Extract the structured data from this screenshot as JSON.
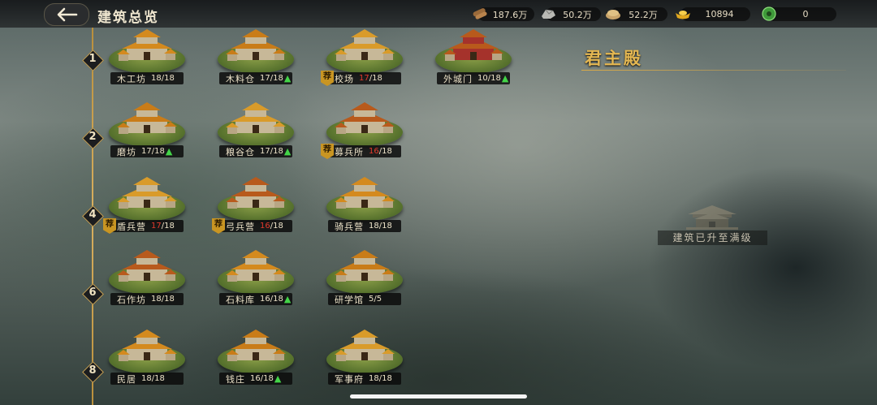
{
  "header": {
    "title": "建筑总览"
  },
  "resources": [
    {
      "icon": "wood-icon",
      "value": "187.6万"
    },
    {
      "icon": "stone-icon",
      "value": "50.2万"
    },
    {
      "icon": "grain-icon",
      "value": "52.2万"
    },
    {
      "icon": "gold-ingot-icon",
      "value": "10894"
    },
    {
      "icon": "jade-icon",
      "value": "0"
    }
  ],
  "tiers": [
    "1",
    "2",
    "4",
    "6",
    "8"
  ],
  "buildings": [
    {
      "name": "木工坊",
      "current": "18",
      "max": "18",
      "red": false,
      "upgrade": false,
      "badge": ""
    },
    {
      "name": "木料仓",
      "current": "17",
      "max": "18",
      "red": false,
      "upgrade": true,
      "badge": ""
    },
    {
      "name": "校场",
      "current": "17",
      "max": "18",
      "red": true,
      "upgrade": false,
      "badge": "荐"
    },
    {
      "name": "外城门",
      "current": "10",
      "max": "18",
      "red": false,
      "upgrade": true,
      "badge": ""
    },
    {
      "name": "磨坊",
      "current": "17",
      "max": "18",
      "red": false,
      "upgrade": true,
      "badge": ""
    },
    {
      "name": "粮谷仓",
      "current": "17",
      "max": "18",
      "red": false,
      "upgrade": true,
      "badge": ""
    },
    {
      "name": "募兵所",
      "current": "16",
      "max": "18",
      "red": true,
      "upgrade": false,
      "badge": "荐"
    },
    {
      "name": "盾兵营",
      "current": "17",
      "max": "18",
      "red": true,
      "upgrade": false,
      "badge": "荐"
    },
    {
      "name": "弓兵营",
      "current": "16",
      "max": "18",
      "red": true,
      "upgrade": false,
      "badge": "荐"
    },
    {
      "name": "骑兵营",
      "current": "18",
      "max": "18",
      "red": false,
      "upgrade": false,
      "badge": ""
    },
    {
      "name": "石作坊",
      "current": "18",
      "max": "18",
      "red": false,
      "upgrade": false,
      "badge": ""
    },
    {
      "name": "石料库",
      "current": "16",
      "max": "18",
      "red": false,
      "upgrade": true,
      "badge": ""
    },
    {
      "name": "研学馆",
      "current": "5",
      "max": "5",
      "red": false,
      "upgrade": false,
      "badge": ""
    },
    {
      "name": "民居",
      "current": "18",
      "max": "18",
      "red": false,
      "upgrade": false,
      "badge": ""
    },
    {
      "name": "钱庄",
      "current": "16",
      "max": "18",
      "red": false,
      "upgrade": true,
      "badge": ""
    },
    {
      "name": "军事府",
      "current": "18",
      "max": "18",
      "red": false,
      "upgrade": false,
      "badge": ""
    }
  ],
  "detail": {
    "title": "君主殿",
    "status": "建筑已升至满级"
  },
  "colors": {
    "accent": "#e4b752",
    "level_warn": "#e23a2c",
    "upgrade": "#43d448"
  }
}
